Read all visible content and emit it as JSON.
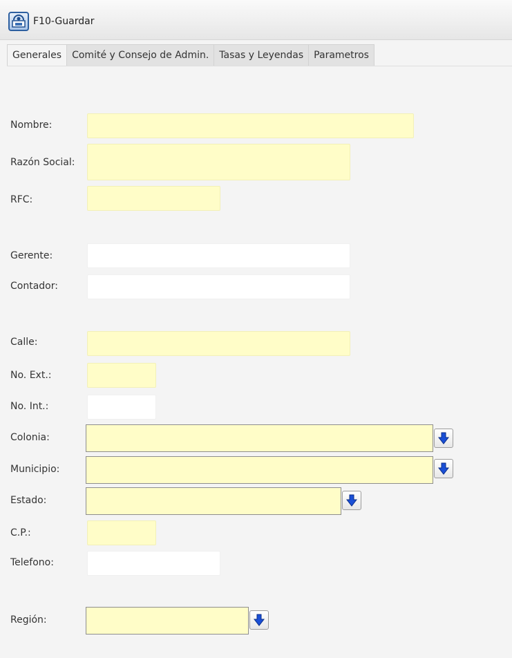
{
  "toolbar": {
    "save_label": "F10-Guardar"
  },
  "tabs": [
    {
      "label": "Generales"
    },
    {
      "label": "Comité y Consejo de Admin."
    },
    {
      "label": "Tasas y Leyendas"
    },
    {
      "label": "Parametros"
    }
  ],
  "form": {
    "nombre": {
      "label": "Nombre:",
      "value": ""
    },
    "razon_social": {
      "label": "Razón Social:",
      "value": ""
    },
    "rfc": {
      "label": "RFC:",
      "value": ""
    },
    "gerente": {
      "label": "Gerente:",
      "value": ""
    },
    "contador": {
      "label": "Contador:",
      "value": ""
    },
    "calle": {
      "label": "Calle:",
      "value": ""
    },
    "no_ext": {
      "label": "No. Ext.:",
      "value": ""
    },
    "no_int": {
      "label": "No. Int.:",
      "value": ""
    },
    "colonia": {
      "label": "Colonia:",
      "value": ""
    },
    "municipio": {
      "label": "Municipio:",
      "value": ""
    },
    "estado": {
      "label": "Estado:",
      "value": ""
    },
    "cp": {
      "label": "C.P.:",
      "value": ""
    },
    "telefono": {
      "label": "Telefono:",
      "value": ""
    },
    "region": {
      "label": "Región:",
      "value": ""
    }
  },
  "colors": {
    "required_field": "#fffdc8",
    "optional_field": "#ffffff",
    "dropdown_arrow": "#1a4fd6",
    "background": "#f4f4f4"
  },
  "icons": {
    "save": "save-icon",
    "dropdown": "arrow-down-icon"
  }
}
